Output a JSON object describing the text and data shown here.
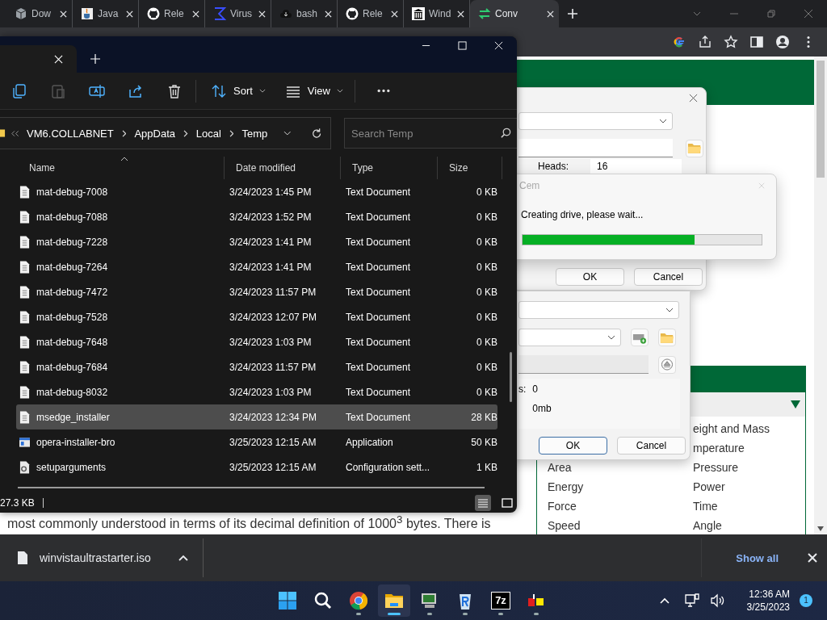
{
  "browser": {
    "tabs": [
      {
        "title": "Dow",
        "kind": "cube",
        "selected": false
      },
      {
        "title": "Java",
        "kind": "cup",
        "selected": false
      },
      {
        "title": "Rele",
        "kind": "octo",
        "selected": false
      },
      {
        "title": "Virus",
        "kind": "sigma",
        "selected": false
      },
      {
        "title": "bash",
        "kind": "cloud",
        "selected": false
      },
      {
        "title": "Rele",
        "kind": "octo",
        "selected": false
      },
      {
        "title": "Wind",
        "kind": "building",
        "selected": false
      },
      {
        "title": "Conv",
        "kind": "arrows",
        "selected": true
      }
    ]
  },
  "page": {
    "paragraph": "most commonly understood in terms of its decimal definition of 1000$^{3}$ bytes. There is",
    "unit_panel": {
      "left_column": [
        "Area",
        "Energy",
        "Force",
        "Speed"
      ],
      "right_column": [
        "eight and Mass",
        "mperature",
        "Pressure",
        "Power",
        "Time",
        "Angle"
      ]
    }
  },
  "explorer": {
    "toolbar": [
      {
        "kind": "copy",
        "disabled": false
      },
      {
        "kind": "paste",
        "disabled": true
      },
      {
        "kind": "rename",
        "disabled": false
      },
      {
        "kind": "share",
        "disabled": false
      },
      {
        "kind": "delete",
        "disabled": false
      }
    ],
    "sort_button": "Sort",
    "view_button": "View",
    "crumbs": [
      "VM6.COLLABNET",
      "AppData",
      "Local",
      "Temp"
    ],
    "search": {
      "placeholder": "Search Temp"
    },
    "columns": [
      "Name",
      "Date modified",
      "Type",
      "Size"
    ],
    "rows": [
      {
        "name": "mat-debug-7008",
        "date": "3/24/2023 1:45 PM",
        "type": "Text Document",
        "size": "0 KB",
        "kind": "text",
        "selected": false
      },
      {
        "name": "mat-debug-7088",
        "date": "3/24/2023 1:52 PM",
        "type": "Text Document",
        "size": "0 KB",
        "kind": "text",
        "selected": false
      },
      {
        "name": "mat-debug-7228",
        "date": "3/24/2023 1:41 PM",
        "type": "Text Document",
        "size": "0 KB",
        "kind": "text",
        "selected": false
      },
      {
        "name": "mat-debug-7264",
        "date": "3/24/2023 1:41 PM",
        "type": "Text Document",
        "size": "0 KB",
        "kind": "text",
        "selected": false
      },
      {
        "name": "mat-debug-7472",
        "date": "3/24/2023 11:57 PM",
        "type": "Text Document",
        "size": "0 KB",
        "kind": "text",
        "selected": false
      },
      {
        "name": "mat-debug-7528",
        "date": "3/24/2023 12:07 PM",
        "type": "Text Document",
        "size": "0 KB",
        "kind": "text",
        "selected": false
      },
      {
        "name": "mat-debug-7648",
        "date": "3/24/2023 1:03 PM",
        "type": "Text Document",
        "size": "0 KB",
        "kind": "text",
        "selected": false
      },
      {
        "name": "mat-debug-7684",
        "date": "3/24/2023 11:57 PM",
        "type": "Text Document",
        "size": "0 KB",
        "kind": "text",
        "selected": false
      },
      {
        "name": "mat-debug-8032",
        "date": "3/24/2023 1:03 PM",
        "type": "Text Document",
        "size": "0 KB",
        "kind": "text",
        "selected": false
      },
      {
        "name": "msedge_installer",
        "date": "3/24/2023 12:34 PM",
        "type": "Text Document",
        "size": "28 KB",
        "kind": "text",
        "selected": true
      },
      {
        "name": "opera-installer-bro",
        "date": "3/25/2023 12:15 AM",
        "type": "Application",
        "size": "50 KB",
        "kind": "app",
        "selected": false
      },
      {
        "name": "setuparguments",
        "date": "3/25/2023 12:15 AM",
        "type": "Configuration sett...",
        "size": "1 KB",
        "kind": "config",
        "selected": false
      }
    ],
    "status": "27.3 KB",
    "views": [
      {
        "kind": "details",
        "selected": true
      },
      {
        "kind": "tiles",
        "selected": false
      }
    ]
  },
  "dialog": {
    "heads_label": "Heads:",
    "heads_value": "16",
    "buttons": [
      "OK",
      "Cancel"
    ]
  },
  "progress_popup": {
    "title": "Cem",
    "message": "Creating drive, please wait...",
    "level": 0.72
  },
  "dialog_2": {
    "label": "s:",
    "value": "0",
    "size": "0mb",
    "buttons": [
      {
        "label": "OK",
        "default": true
      },
      {
        "label": "Cancel",
        "default": false
      }
    ]
  },
  "downloads": {
    "file": "winvistaultrastarter.iso",
    "show_all": "Show all"
  },
  "taskbar": {
    "apps": [
      {
        "kind": "start",
        "running": false,
        "selected": false
      },
      {
        "kind": "search",
        "running": false,
        "selected": false
      },
      {
        "kind": "wheel",
        "running": true,
        "selected": false
      },
      {
        "kind": "folder",
        "running": true,
        "selected": true
      },
      {
        "kind": "monitor",
        "running": true,
        "selected": false
      },
      {
        "kind": "bin",
        "running": true,
        "selected": false
      },
      {
        "kind": "zip",
        "glyph": "7z",
        "running": true,
        "selected": false
      },
      {
        "kind": "blocks",
        "running": true,
        "selected": false
      }
    ],
    "time": "12:36 AM",
    "date": "3/25/2023",
    "badge": "1"
  }
}
